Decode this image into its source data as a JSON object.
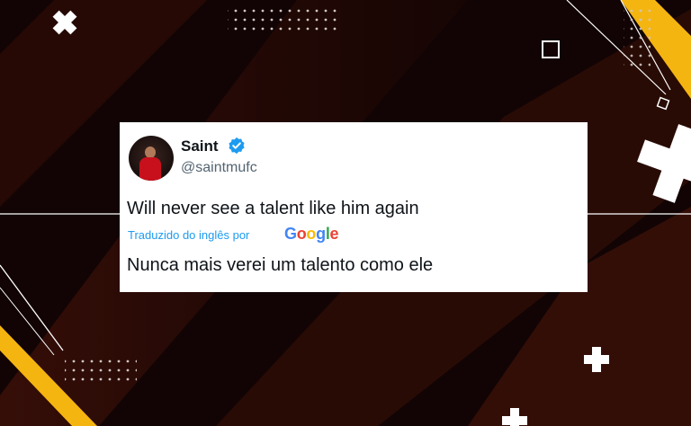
{
  "tweet": {
    "display_name": "Saint",
    "handle": "@saintmufc",
    "verified": true,
    "text": "Will never see a talent like him again",
    "translated_label": "Traduzido do inglês por",
    "translator_brand": [
      "G",
      "o",
      "o",
      "g",
      "l",
      "e"
    ],
    "translation": "Nunca mais verei um talento como ele"
  },
  "colors": {
    "background": "#120404",
    "accent_yellow": "#f5b511",
    "brand_blue": "#1d9bf0",
    "google_blue": "#4285f4",
    "google_red": "#ea4335",
    "google_yellow": "#fbbc05",
    "google_green": "#34a853"
  },
  "icons": [
    "verified-badge-icon",
    "plus-icon",
    "square-outline-icon",
    "dot-grid-icon"
  ]
}
